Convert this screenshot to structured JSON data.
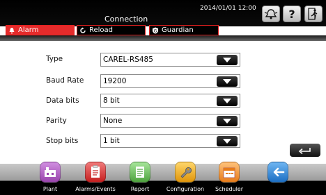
{
  "header": {
    "title": "Connection",
    "datetime": "2014/01/01  12:00"
  },
  "tabs": [
    {
      "label": "Alarm"
    },
    {
      "label": "Reload"
    },
    {
      "label": "Guardian"
    }
  ],
  "form": [
    {
      "label": "Type",
      "value": "CAREL-RS485"
    },
    {
      "label": "Baud Rate",
      "value": "19200"
    },
    {
      "label": "Data bits",
      "value": "8 bit"
    },
    {
      "label": "Parity",
      "value": "None"
    },
    {
      "label": "Stop bits",
      "value": "1 bit"
    }
  ],
  "nav": [
    {
      "label": "Plant",
      "color": "#b05fc0"
    },
    {
      "label": "Alarms/Events",
      "color": "#e23c3c"
    },
    {
      "label": "Report",
      "color": "#6ac35a"
    },
    {
      "label": "Configuration",
      "color": "#f3b21e"
    },
    {
      "label": "Scheduler",
      "color": "#f09a3a"
    },
    {
      "label": "",
      "color": "#2c86d9"
    }
  ],
  "colors": {
    "accent": "#e52b2b"
  }
}
